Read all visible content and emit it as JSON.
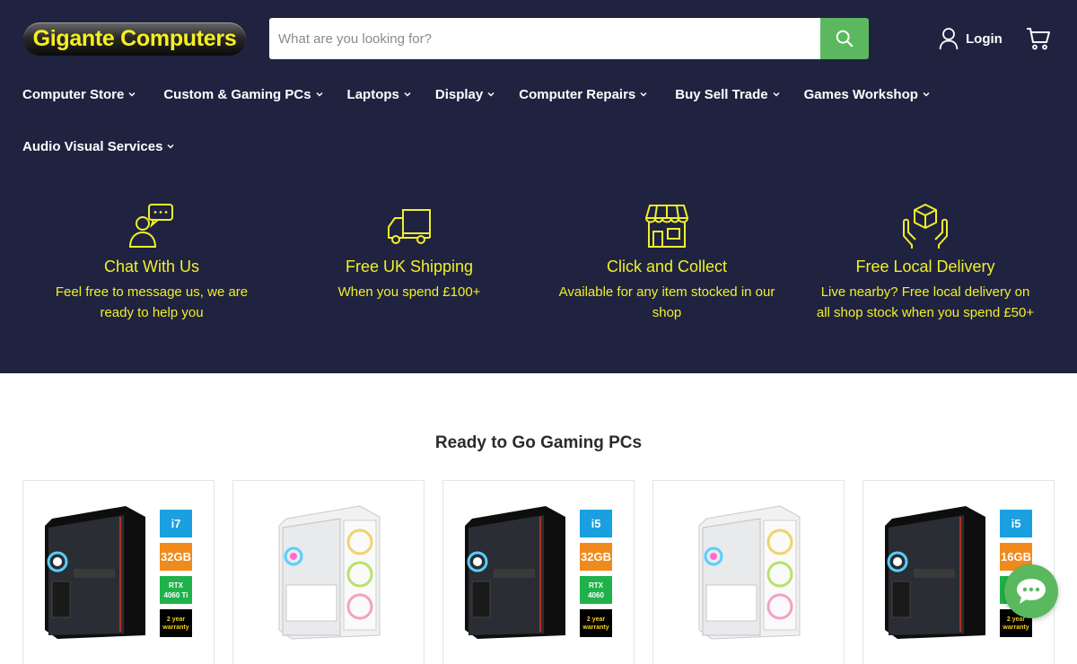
{
  "brand": {
    "name": "Gigante Computers"
  },
  "search": {
    "placeholder": "What are you looking for?"
  },
  "account": {
    "login_label": "Login"
  },
  "nav": {
    "row1": [
      "Computer Store",
      "Custom & Gaming PCs",
      "Laptops",
      "Display",
      "Computer Repairs",
      "Buy Sell Trade",
      "Games Workshop"
    ],
    "row2": [
      "Audio Visual Services"
    ]
  },
  "features": [
    {
      "title": "Chat With Us",
      "description": "Feel free to message us, we are ready to help you",
      "icon": "chat-support-icon"
    },
    {
      "title": "Free UK Shipping",
      "description": "When you spend £100+",
      "icon": "delivery-truck-icon"
    },
    {
      "title": "Click and Collect",
      "description": "Available for any item stocked in our shop",
      "icon": "shop-storefront-icon"
    },
    {
      "title": "Free Local Delivery",
      "description": "Live nearby? Free local delivery on all shop stock when you spend £50+",
      "icon": "hands-box-icon"
    }
  ],
  "section": {
    "title": "Ready to Go Gaming PCs"
  },
  "products": [
    {
      "case_color": "black",
      "tags": [
        {
          "text": "i7",
          "color": "#1aa0e0"
        },
        {
          "text": "32GB",
          "color": "#f08a1c"
        },
        {
          "text": "RTX 4060 Ti",
          "color": "#1fb24a"
        },
        {
          "text": "2 year warranty",
          "color": "#000000"
        }
      ]
    },
    {
      "case_color": "white",
      "tags": []
    },
    {
      "case_color": "black",
      "tags": [
        {
          "text": "i5",
          "color": "#1aa0e0"
        },
        {
          "text": "32GB",
          "color": "#f08a1c"
        },
        {
          "text": "RTX 4060",
          "color": "#1fb24a"
        },
        {
          "text": "2 year warranty",
          "color": "#000000"
        }
      ]
    },
    {
      "case_color": "white",
      "tags": []
    },
    {
      "case_color": "black",
      "tags": [
        {
          "text": "i5",
          "color": "#1aa0e0"
        },
        {
          "text": "16GB",
          "color": "#f08a1c"
        },
        {
          "text": "",
          "color": "#1fb24a"
        },
        {
          "text": "2 year warranty",
          "color": "#000000"
        }
      ]
    }
  ],
  "colors": {
    "header_bg": "#1f2340",
    "accent_yellow": "#f2ef2a",
    "search_button": "#5bb85f",
    "chat_widget": "#5ab95e"
  }
}
